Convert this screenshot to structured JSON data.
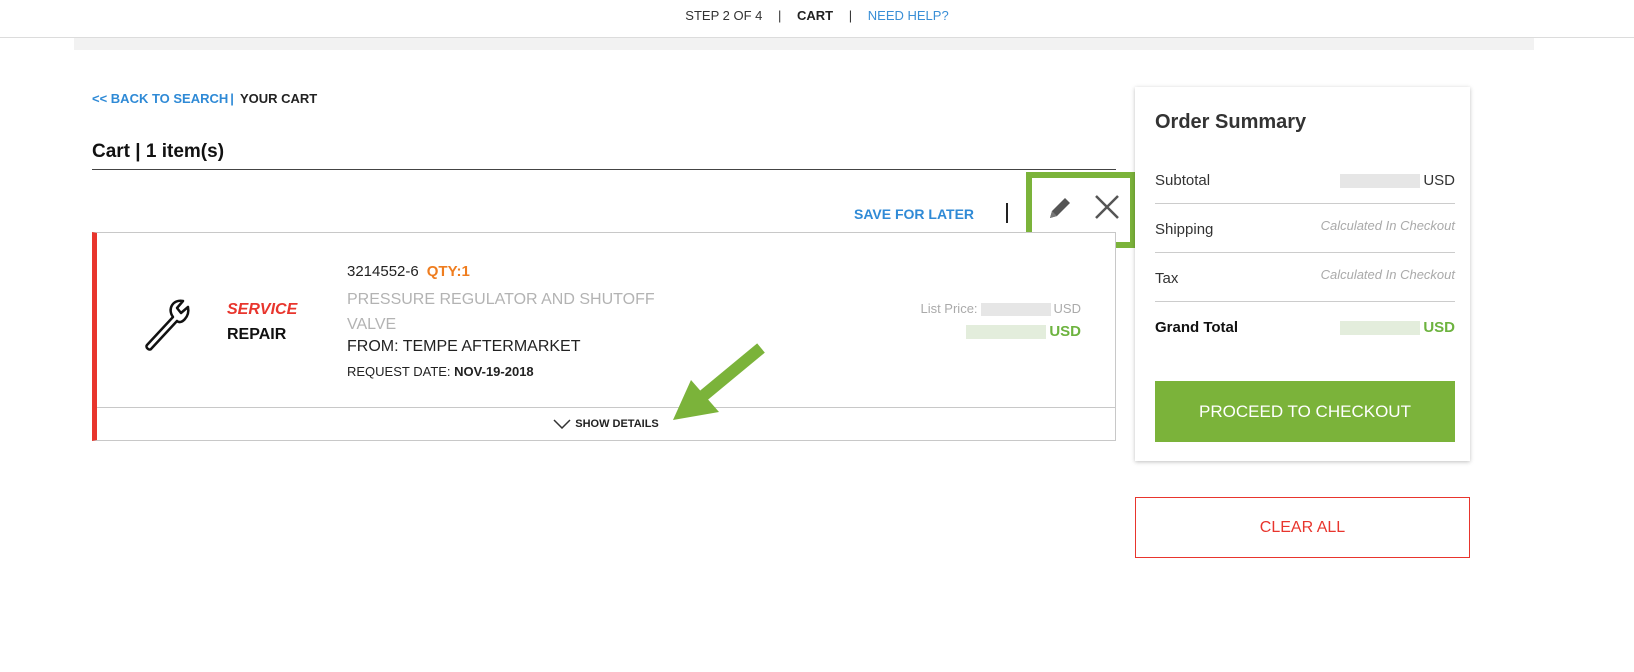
{
  "header": {
    "step": "STEP 2 OF 4",
    "separator": "|",
    "current": "CART",
    "help": "NEED HELP?"
  },
  "breadcrumb": {
    "back": "<< BACK TO SEARCH",
    "separator": "|",
    "current": "YOUR CART"
  },
  "cart": {
    "title": "Cart | 1 item(s)",
    "save_for_later": "SAVE FOR LATER",
    "item": {
      "service_type": "SERVICE",
      "service_subtype": "REPAIR",
      "part_number": "3214552-6",
      "qty": "QTY:1",
      "description": "PRESSURE REGULATOR AND SHUTOFF VALVE",
      "from": "FROM: TEMPE AFTERMARKET",
      "request_date_label": "REQUEST DATE:",
      "request_date": "NOV-19-2018",
      "list_price_label": "List Price:",
      "currency": "USD",
      "show_details": "SHOW DETAILS"
    }
  },
  "summary": {
    "title": "Order Summary",
    "subtotal_label": "Subtotal",
    "subtotal_currency": "USD",
    "shipping_label": "Shipping",
    "shipping_value": "Calculated In Checkout",
    "tax_label": "Tax",
    "tax_value": "Calculated In Checkout",
    "grand_total_label": "Grand Total",
    "grand_total_currency": "USD",
    "checkout_button": "PROCEED TO CHECKOUT"
  },
  "clear_all": "CLEAR ALL",
  "colors": {
    "accent_green": "#7bb33a",
    "link_blue": "#2f8ad6",
    "alert_red": "#e8352d",
    "qty_orange": "#ef7d1f"
  },
  "icons": [
    "pencil-icon",
    "close-icon",
    "wrench-icon",
    "chevron-down-icon",
    "arrow-annotation"
  ]
}
